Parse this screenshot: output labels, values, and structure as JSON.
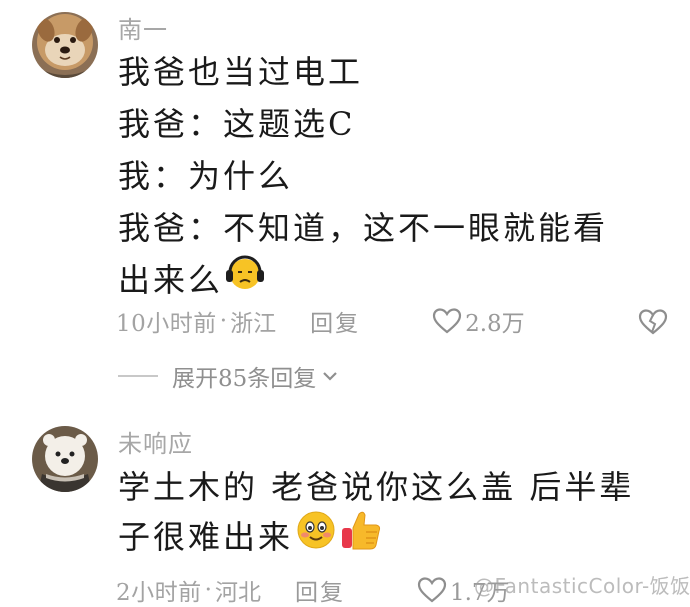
{
  "comments": [
    {
      "username": "南一",
      "avatar": "dog-avatar",
      "lines": [
        "我爸也当过电工",
        "我爸：这题选C",
        "我：为什么",
        "我爸：不知道，这不一眼就能看",
        "出来么"
      ],
      "emoji": [
        "headphone-face-emoji"
      ],
      "time": "10小时前",
      "location": "浙江",
      "reply_label": "回复",
      "likes": "2.8万",
      "expand_label": "展开85条回复"
    },
    {
      "username": "未响应",
      "avatar": "bear-avatar",
      "lines": [
        "学土木的 老爸说你这么盖 后半辈",
        "子很难出来"
      ],
      "emoji": [
        "blushing-face-emoji",
        "thumbs-up-emoji"
      ],
      "time": "2小时前",
      "location": "河北",
      "reply_label": "回复",
      "likes": "1.7万"
    }
  ],
  "separator": "·",
  "watermark": "@FantasticColor-饭饭",
  "colors": {
    "background": "#ffffff",
    "text": "#1a1a1a",
    "muted": "#a7a7a7",
    "emoji_yellow": "#f7c325"
  }
}
